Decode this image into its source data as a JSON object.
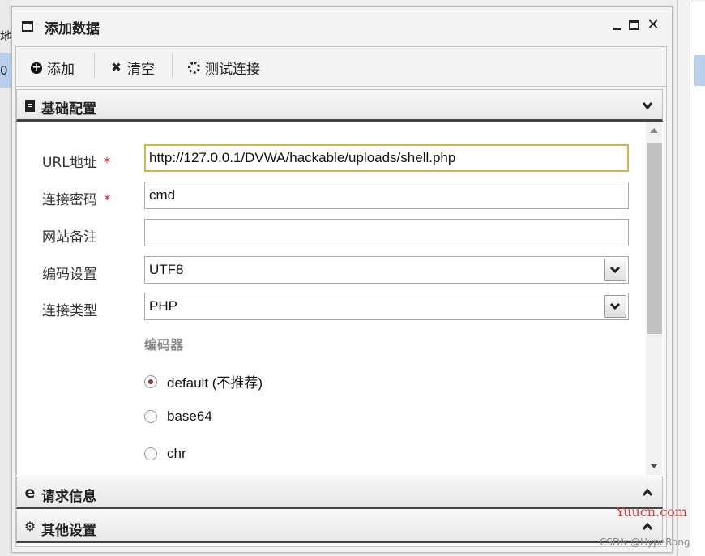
{
  "background": {
    "left_cut_text": "地",
    "left_cut_text2": "0"
  },
  "window": {
    "title": "添加数据"
  },
  "toolbar": {
    "add_label": "添加",
    "clear_label": "清空",
    "test_label": "测试连接"
  },
  "sections": {
    "basic": "基础配置",
    "request": "请求信息",
    "other": "其他设置"
  },
  "form": {
    "url": {
      "label": "URL地址",
      "required": "*",
      "value": "http://127.0.0.1/DVWA/hackable/uploads/shell.php"
    },
    "password": {
      "label": "连接密码",
      "required": "*",
      "value": "cmd"
    },
    "note": {
      "label": "网站备注",
      "value": ""
    },
    "encoding": {
      "label": "编码设置",
      "value": "UTF8"
    },
    "type": {
      "label": "连接类型",
      "value": "PHP"
    },
    "encoder": {
      "title": "编码器",
      "options": [
        {
          "label": "default (不推荐)",
          "checked": true
        },
        {
          "label": "base64",
          "checked": false
        },
        {
          "label": "chr",
          "checked": false
        }
      ]
    }
  },
  "watermarks": {
    "site": "Yuucn.com",
    "author": "CSDN @HypeRong"
  },
  "colors": {
    "required": "#d92020",
    "focus_border": "#d9b04c",
    "selection": "#b8d0ec"
  }
}
